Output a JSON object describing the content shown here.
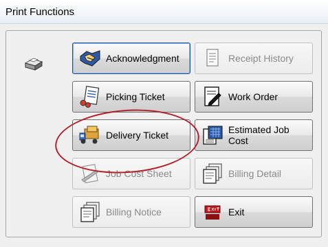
{
  "window": {
    "title": "Print Functions"
  },
  "buttons": {
    "acknowledgment": {
      "label": "Acknowledgment",
      "enabled": true
    },
    "receipt_history": {
      "label": "Receipt History",
      "enabled": false
    },
    "picking_ticket": {
      "label": "Picking Ticket",
      "enabled": true
    },
    "work_order": {
      "label": "Work Order",
      "enabled": true
    },
    "delivery_ticket": {
      "label": "Delivery Ticket",
      "enabled": true
    },
    "estimated_job_cost": {
      "label": "Estimated Job Cost",
      "enabled": true
    },
    "job_cost_sheet": {
      "label": "Job Cost Sheet",
      "enabled": false
    },
    "billing_detail": {
      "label": "Billing Detail",
      "enabled": false
    },
    "billing_notice": {
      "label": "Billing Notice",
      "enabled": false
    },
    "exit": {
      "label": "Exit",
      "enabled": true
    }
  },
  "icons": {
    "printer": "printer-icon",
    "acknowledgment": "handshake-icon",
    "receipt_history": "document-icon",
    "picking_ticket": "clipboard-icon",
    "work_order": "pen-document-icon",
    "delivery_ticket": "delivery-truck-icon",
    "estimated_job_cost": "calculator-icon",
    "job_cost_sheet": "job-cost-icon",
    "billing_detail": "stacked-documents-icon",
    "billing_notice": "stacked-documents-icon",
    "exit": "exit-sign-icon"
  },
  "colors": {
    "highlight_circle": "#b3222b",
    "focus_border": "#1a4fa6"
  }
}
